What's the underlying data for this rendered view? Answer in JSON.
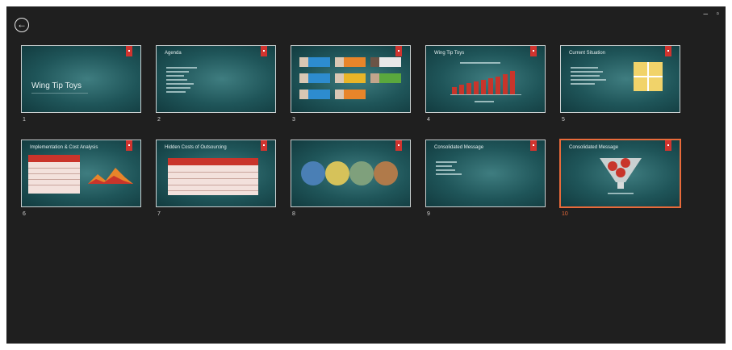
{
  "window": {
    "back_icon": "back-arrow-icon",
    "minimize_label": "–",
    "maximize_label": "▫"
  },
  "slides": [
    {
      "number": "1",
      "title": "Wing Tip Toys"
    },
    {
      "number": "2",
      "title": "Agenda"
    },
    {
      "number": "3",
      "title": ""
    },
    {
      "number": "4",
      "title": "Wing Tip Toys"
    },
    {
      "number": "5",
      "title": "Current Situation"
    },
    {
      "number": "6",
      "title": "Implementation & Cost Analysis"
    },
    {
      "number": "7",
      "title": "Hidden Costs of Outsourcing"
    },
    {
      "number": "8",
      "title": ""
    },
    {
      "number": "9",
      "title": "Consolidated Message"
    },
    {
      "number": "10",
      "title": "Consolidated Message"
    }
  ],
  "selected_slide": "10",
  "colors": {
    "accent_red": "#d1342f",
    "selected_border": "#e96a3a",
    "background": "#1f1f1f"
  }
}
